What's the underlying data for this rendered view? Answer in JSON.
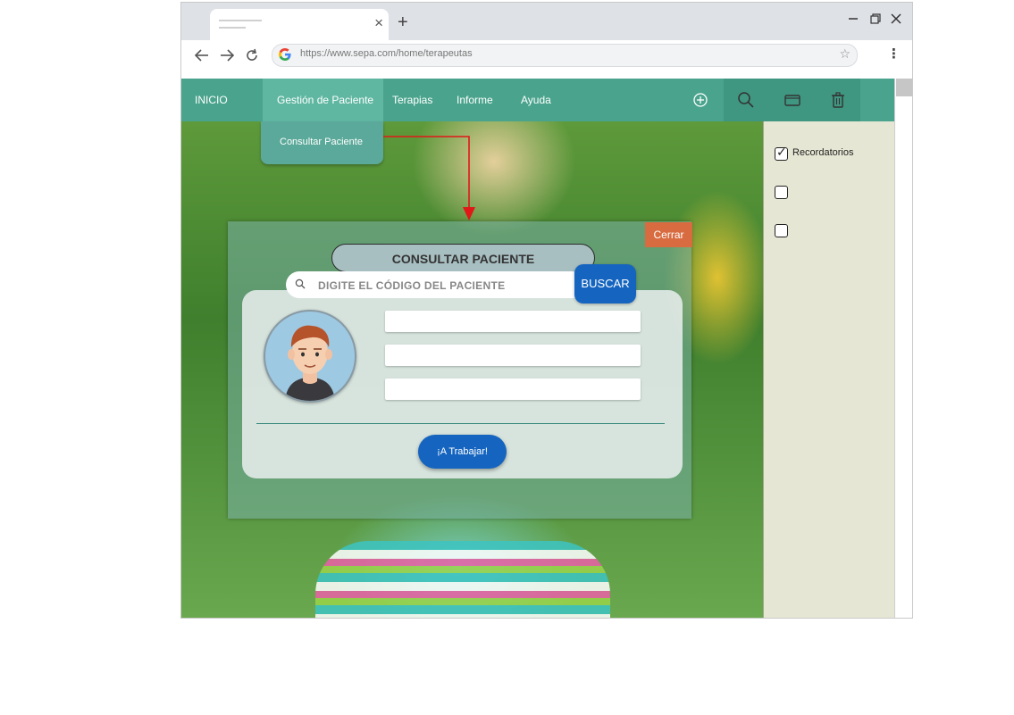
{
  "browser": {
    "url": "https://www.sepa.com/home/terapeutas",
    "new_tab_label": "+",
    "tab_close": "×"
  },
  "nav": {
    "items": [
      {
        "label": "INICIO"
      },
      {
        "label": "Gestión de Paciente"
      },
      {
        "label": "Terapias"
      },
      {
        "label": "Informe"
      },
      {
        "label": "Ayuda"
      }
    ],
    "icons": [
      "add-circle-icon",
      "search-icon",
      "folder-icon",
      "trash-icon"
    ],
    "dropdown_item": "Consultar Paciente",
    "color": "#4aa48d"
  },
  "sidebar": {
    "reminders_label": "Recordatorios",
    "checkboxes": [
      {
        "label": "Recordatorios",
        "checked": true
      },
      {
        "label": "",
        "checked": false
      },
      {
        "label": "",
        "checked": false
      }
    ]
  },
  "modal": {
    "close_label": "Cerrar",
    "title": "CONSULTAR PACIENTE",
    "search_placeholder": "DIGITE EL CÓDIGO DEL PACIENTE",
    "search_value": "",
    "search_button": "BUSCAR",
    "fields": [
      "",
      "",
      ""
    ],
    "action_button": "¡A Trabajar!"
  },
  "colors": {
    "accent_blue": "#1565c0",
    "close_orange": "#d86b3f",
    "sidebar_bg": "#e6e6d4"
  }
}
